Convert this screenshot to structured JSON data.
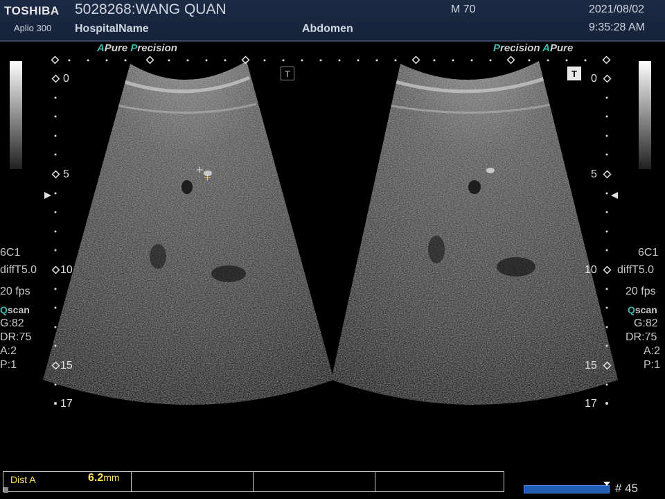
{
  "header": {
    "brand": "TOSHIBA",
    "model": "Aplio 300",
    "patient": "5028268:WANG QUAN",
    "hospital": "HospitalName",
    "exam": "Abdomen",
    "mi": "M 70",
    "date": "2021/08/02",
    "time": "9:35:28 AM"
  },
  "labels": {
    "left_cap1": "A",
    "left_word1": "Pure",
    "left_cap2": "P",
    "left_word2": "recision",
    "right_cap1": "P",
    "right_word1": "recision",
    "right_cap2": "A",
    "right_word2": "Pure"
  },
  "depth": {
    "marks": [
      "0",
      "5",
      "10",
      "15",
      "17"
    ]
  },
  "params": {
    "probe": "6C1",
    "mode": "diffT5.0",
    "fps": "20 fps",
    "qscan_q": "Q",
    "qscan_rest": "scan",
    "gain": "G:82",
    "dr": "DR:75",
    "a": "A:2",
    "p": "P:1"
  },
  "tmark": "T",
  "measurement": {
    "label": "Dist A",
    "value": "6.2",
    "unit": "mm"
  },
  "cine": {
    "progress": 1.0,
    "frame": "# 45"
  },
  "colors": {
    "header_bg": "#1d2a44",
    "accent_teal": "#3fb8b0",
    "measure_yellow": "#ffe25a",
    "cine_blue": "#1f5fb8"
  }
}
